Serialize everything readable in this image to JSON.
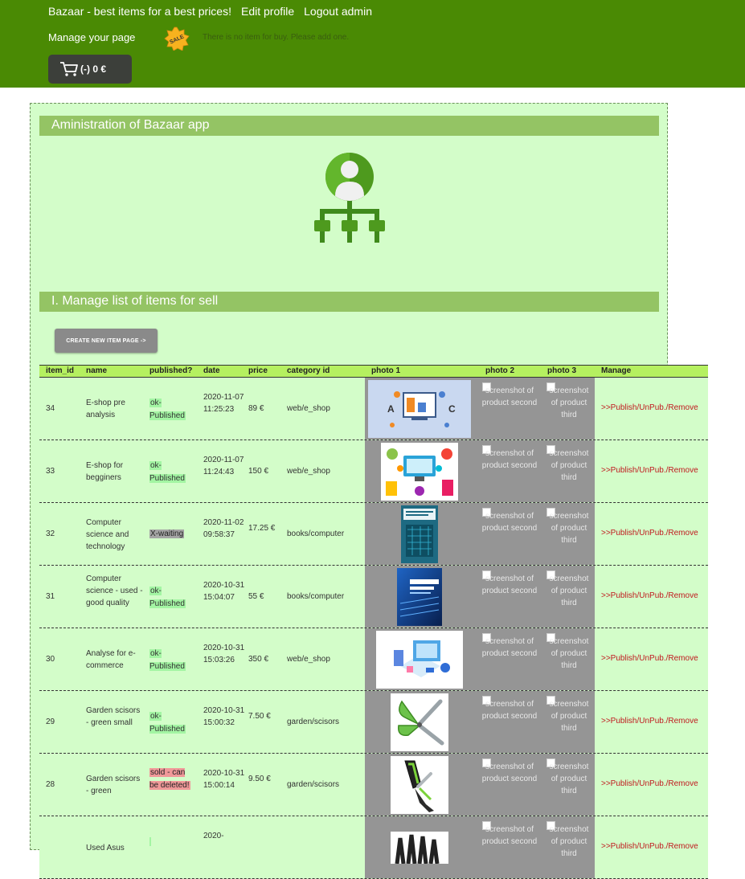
{
  "header": {
    "nav": [
      "Bazaar - best items for a best prices!",
      "Edit profile",
      "Logout admin"
    ],
    "manage_link": "Manage your page",
    "sale_badge": "SALE",
    "notice": "There is no item for buy. Please add one.",
    "cart_label": "(-) 0 €"
  },
  "admin": {
    "title": "Aministration of Bazaar app",
    "section_title": "I. Manage list of items for sell",
    "create_button": "CREATE NEW ITEM PAGE ->"
  },
  "table": {
    "columns": [
      "item_id",
      "name",
      "published?",
      "date",
      "price",
      "category id",
      "photo 1",
      "photo 2",
      "photo 3",
      "Manage"
    ],
    "photo2_alt": "screenshot of product second",
    "photo3_alt": "screenshot of product third",
    "manage_label": ">>Publish/UnPub./Remove",
    "rows": [
      {
        "id": "34",
        "name": "E-shop pre analysis",
        "status": "ok-Published",
        "status_type": "ok",
        "date": "2020-11-07 11:25:23",
        "price": "89 €",
        "category": "web/e_shop",
        "photo": "eshop-analysis"
      },
      {
        "id": "33",
        "name": "E-shop for begginers",
        "status": "ok-Published",
        "status_type": "ok",
        "date": "2020-11-07 11:24:43",
        "price": "150 €",
        "category": "web/e_shop",
        "photo": "eshop-icons"
      },
      {
        "id": "32",
        "name": "Computer science and technology",
        "status": "X-waiting",
        "status_type": "waiting",
        "date": "2020-11-02 09:58:37",
        "price": "17.25 €",
        "category": "books/computer",
        "photo": "book-teal"
      },
      {
        "id": "31",
        "name": "Computer science - used - good quality",
        "status": "ok-Published",
        "status_type": "ok",
        "date": "2020-10-31 15:04:07",
        "price": "55 €",
        "category": "books/computer",
        "photo": "book-blue"
      },
      {
        "id": "30",
        "name": "Analyse for e-commerce",
        "status": "ok-Published",
        "status_type": "ok",
        "date": "2020-10-31 15:03:26",
        "price": "350 €",
        "category": "web/e_shop",
        "photo": "ecommerce-iso"
      },
      {
        "id": "29",
        "name": "Garden scisors - green small",
        "status": "ok-Published",
        "status_type": "ok",
        "date": "2020-10-31 15:00:32",
        "price": "7.50 €",
        "category": "garden/scisors",
        "photo": "scissors"
      },
      {
        "id": "28",
        "name": "Garden scisors - green",
        "status": "sold - can be deleted!",
        "status_type": "sold",
        "date": "2020-10-31 15:00:14",
        "price": "9.50 €",
        "category": "garden/scisors",
        "photo": "pruner"
      },
      {
        "id": "",
        "name": "Used Asus",
        "status": "",
        "status_type": "ok",
        "date": "2020-",
        "price": "",
        "category": "",
        "photo": "dark-tools"
      }
    ]
  },
  "colors": {
    "topbar": "#4a8a04",
    "panel": "#d3fdc9",
    "section": "#94c464",
    "table_header": "#b5f060",
    "manage_link": "#c0191e"
  }
}
